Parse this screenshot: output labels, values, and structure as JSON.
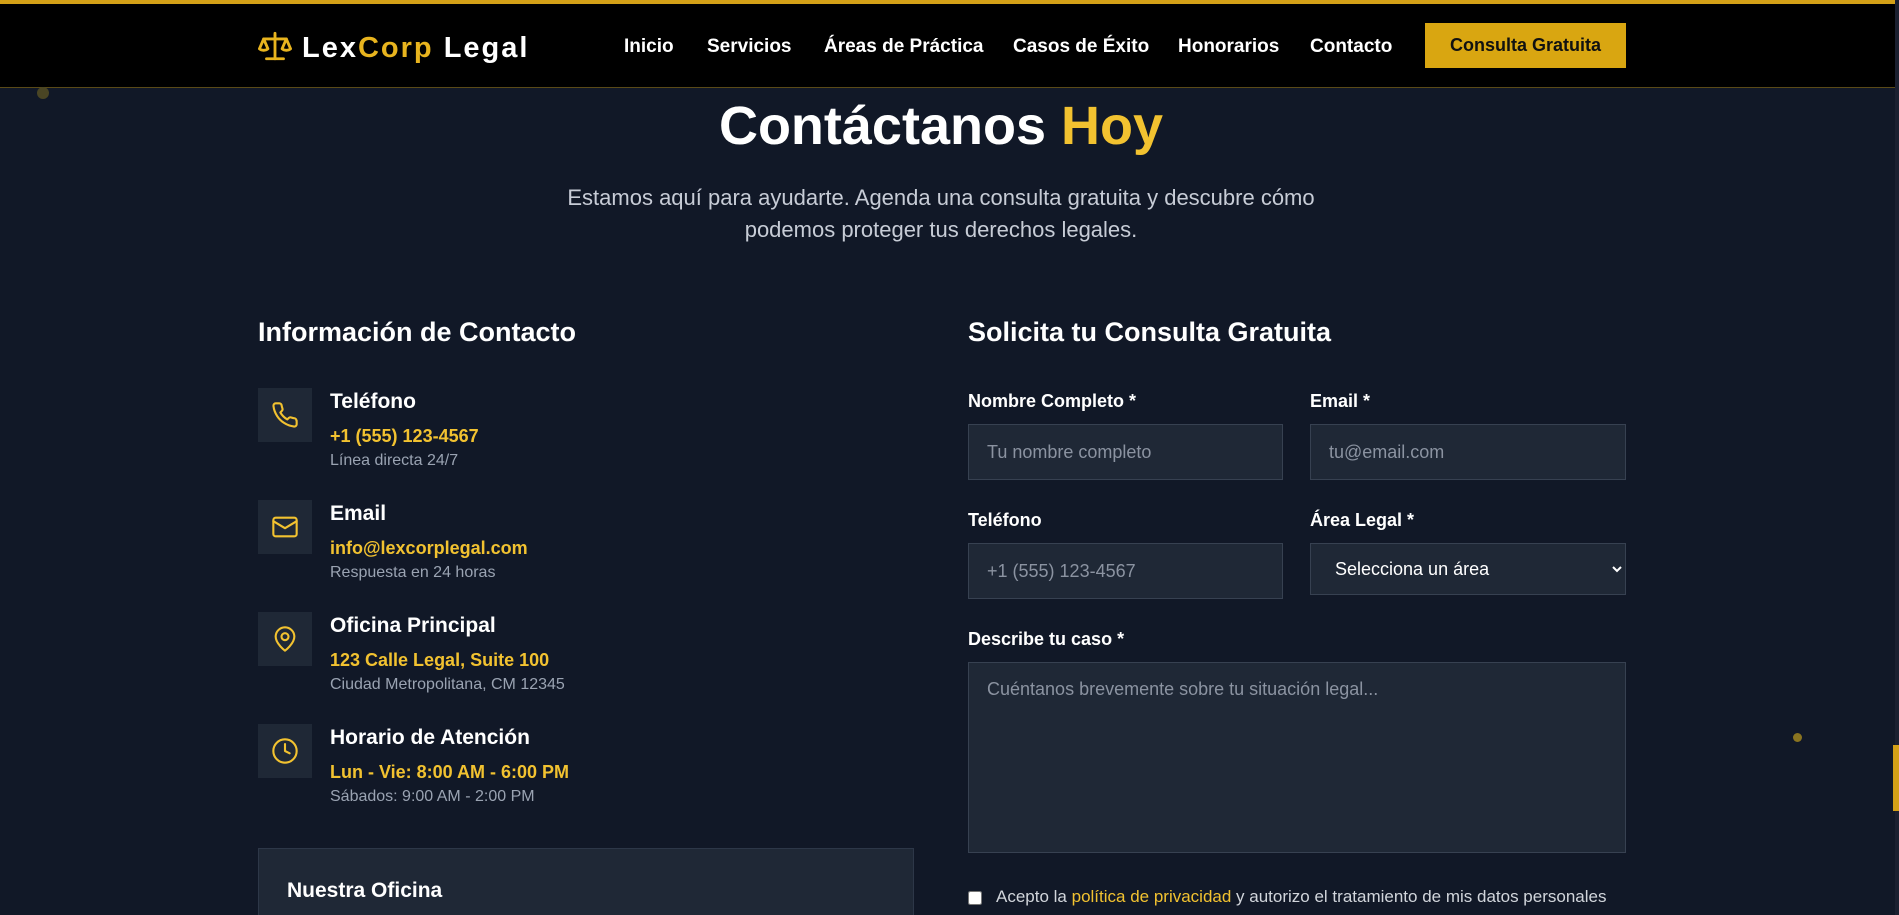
{
  "colors": {
    "accent": "#f2c230",
    "button": "#d9a611",
    "background": "#111827",
    "navbar": "#000000"
  },
  "brand": {
    "part1": "Lex",
    "part2": "Corp",
    "part3": "Legal",
    "icon": "scales-icon"
  },
  "nav": {
    "items": [
      "Inicio",
      "Servicios",
      "Áreas de Práctica",
      "Casos de Éxito",
      "Honorarios",
      "Contacto"
    ],
    "cta": "Consulta Gratuita"
  },
  "hero": {
    "title_main": "Contáctanos",
    "title_highlight": "Hoy",
    "subtitle_line1": "Estamos aquí para ayudarte. Agenda una consulta gratuita y descubre cómo",
    "subtitle_line2": "podemos proteger tus derechos legales."
  },
  "contact_info": {
    "title": "Información de Contacto",
    "items": [
      {
        "icon": "phone-icon",
        "label": "Teléfono",
        "value": "+1 (555) 123-4567",
        "note": "Línea directa 24/7"
      },
      {
        "icon": "mail-icon",
        "label": "Email",
        "value": "info@lexcorplegal.com",
        "note": "Respuesta en 24 horas"
      },
      {
        "icon": "map-pin-icon",
        "label": "Oficina Principal",
        "value": "123 Calle Legal, Suite 100",
        "note": "Ciudad Metropolitana, CM 12345"
      },
      {
        "icon": "clock-icon",
        "label": "Horario de Atención",
        "value": "Lun - Vie: 8:00 AM - 6:00 PM",
        "note": "Sábados: 9:00 AM - 2:00 PM"
      }
    ],
    "office_title": "Nuestra Oficina"
  },
  "form": {
    "title": "Solicita tu Consulta Gratuita",
    "name_label": "Nombre Completo *",
    "name_placeholder": "Tu nombre completo",
    "email_label": "Email *",
    "email_placeholder": "tu@email.com",
    "phone_label": "Teléfono",
    "phone_placeholder": "+1 (555) 123-4567",
    "area_label": "Área Legal *",
    "area_selected": "Selecciona un área",
    "case_label": "Describe tu caso *",
    "case_placeholder": "Cuéntanos brevemente sobre tu situación legal...",
    "consent_pre": "Acepto la ",
    "consent_link": "política de privacidad",
    "consent_post": " y autorizo el tratamiento de mis datos personales"
  }
}
